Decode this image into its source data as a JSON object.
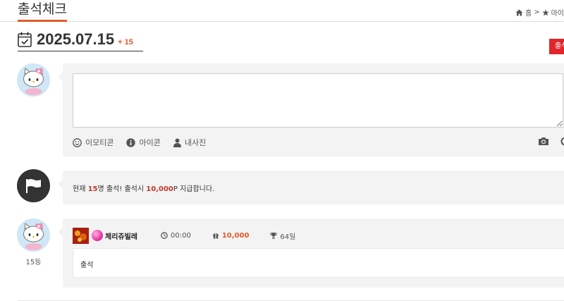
{
  "header": {
    "title": "출석체크",
    "breadcrumb": {
      "home": "홈",
      "separator": ">",
      "current": "마이"
    }
  },
  "date_row": {
    "date": "2025.07.15",
    "count": "+ 15"
  },
  "red_button_label": "출석",
  "composer": {
    "placeholder": "",
    "tools": {
      "emoticon": "이모티콘",
      "icon": "아이콘",
      "my_photo": "내사진"
    }
  },
  "notice": {
    "prefix": "현재 ",
    "count": "15",
    "middle": "명 출석! 출석시 ",
    "points": "10,000",
    "suffix": "P 지급합니다."
  },
  "entry": {
    "nickname": "체리쥬빌레",
    "time": "00:00",
    "points": "10,000",
    "days": "64일",
    "message": "출석",
    "rank": "15등"
  },
  "colors": {
    "accent": "#e05a2a",
    "red_button": "#e0262b",
    "panel_bg": "#f3f3f3"
  },
  "icons": {
    "home": "home-icon",
    "star": "star-icon",
    "calendar": "calendar-check-icon",
    "smile": "smile-icon",
    "info": "info-icon",
    "user": "user-icon",
    "camera": "camera-icon",
    "flag": "flag-icon",
    "clock": "clock-icon",
    "gift": "gift-icon",
    "trophy": "trophy-icon"
  }
}
